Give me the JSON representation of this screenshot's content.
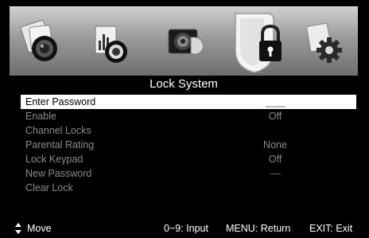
{
  "menu": {
    "icons": [
      {
        "name": "picture-icon"
      },
      {
        "name": "sound-icon"
      },
      {
        "name": "channel-icon"
      },
      {
        "name": "lock-icon"
      },
      {
        "name": "setup-icon"
      }
    ],
    "selected_index": 3
  },
  "page": {
    "title": "Lock System"
  },
  "items": [
    {
      "label": "Enter Password",
      "value": "____"
    },
    {
      "label": "Enable",
      "value": "Off"
    },
    {
      "label": "Channel Locks",
      "value": ""
    },
    {
      "label": "Parental Rating",
      "value": "None"
    },
    {
      "label": "Lock Keypad",
      "value": "Off"
    },
    {
      "label": "New Password",
      "value": "----"
    },
    {
      "label": "Clear Lock",
      "value": ""
    }
  ],
  "footer": {
    "move": "Move",
    "input": "0~9: Input",
    "menu": "MENU: Return",
    "exit": "EXIT: Exit"
  }
}
